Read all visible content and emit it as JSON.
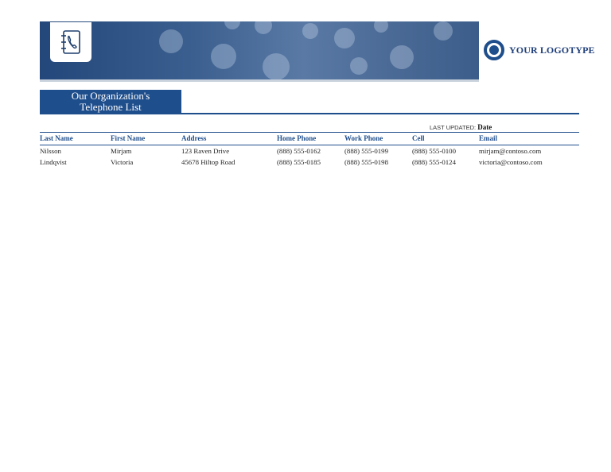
{
  "header": {
    "logo_text": "YOUR LOGOTYPE",
    "title_line1": "Our Organization's",
    "title_line2": "Telephone List",
    "phone_icon": "address-book-phone-icon"
  },
  "last_updated": {
    "label": "LAST UPDATED:",
    "value": "Date"
  },
  "table": {
    "columns": [
      "Last Name",
      "First Name",
      "Address",
      "Home Phone",
      "Work Phone",
      "Cell",
      "Email"
    ],
    "rows": [
      {
        "last_name": "Nilsson",
        "first_name": "Mirjam",
        "address": "123 Raven Drive",
        "home_phone": "(888) 555-0162",
        "work_phone": "(888) 555-0199",
        "cell": "(888) 555-0100",
        "email": "mirjam@contoso.com"
      },
      {
        "last_name": "Lindqvist",
        "first_name": "Victoria",
        "address": "45678 Hiltop Road",
        "home_phone": "(888) 555-0185",
        "work_phone": "(888) 555-0198",
        "cell": "(888) 555-0124",
        "email": "victoria@contoso.com"
      }
    ]
  },
  "colors": {
    "accent": "#1f4e8c",
    "email_link": "#1a2fa8",
    "banner_dark": "#23477a",
    "banner_light": "#5a7aa5"
  }
}
